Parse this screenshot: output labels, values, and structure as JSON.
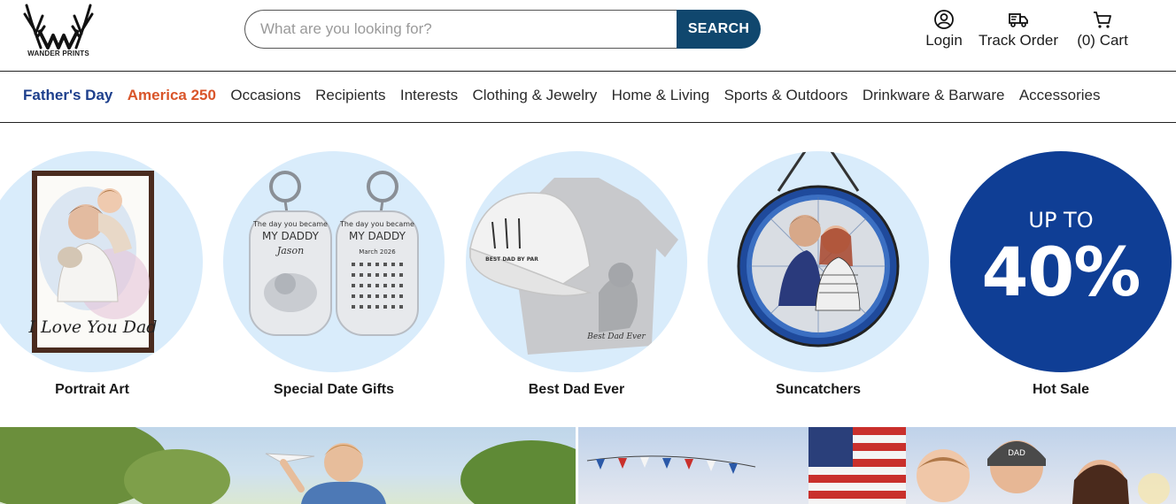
{
  "brand": {
    "name": "WANDER PRINTS"
  },
  "search": {
    "placeholder": "What are you looking for?",
    "button_label": "SEARCH"
  },
  "header_actions": {
    "login": "Login",
    "track_order": "Track Order",
    "cart": "(0) Cart"
  },
  "nav": {
    "items": [
      "Father's Day",
      "America 250",
      "Occasions",
      "Recipients",
      "Interests",
      "Clothing & Jewelry",
      "Home & Living",
      "Sports & Outdoors",
      "Drinkware & Barware",
      "Accessories"
    ]
  },
  "categories": [
    {
      "label": "Portrait Art",
      "caption": "I Love You Dad"
    },
    {
      "label": "Special Date Gifts",
      "caption_top": "The day you became",
      "caption_main": "MY DADDY",
      "name": "Jason",
      "month": "March 2026"
    },
    {
      "label": "Best Dad Ever",
      "cap_text": "BEST DAD BY PAR",
      "shirt_text": "Best Dad Ever"
    },
    {
      "label": "Suncatchers"
    },
    {
      "label": "Hot Sale",
      "promo_line1": "UP TO",
      "promo_line2": "40%"
    }
  ],
  "banner_right": {
    "cap_text": "DAD"
  },
  "colors": {
    "brand_navy": "#10476e",
    "fathers_day": "#1d3f8c",
    "america_250": "#d9552a",
    "circle_bg": "#d9ecfb",
    "sale_bg": "#0f3e95"
  }
}
